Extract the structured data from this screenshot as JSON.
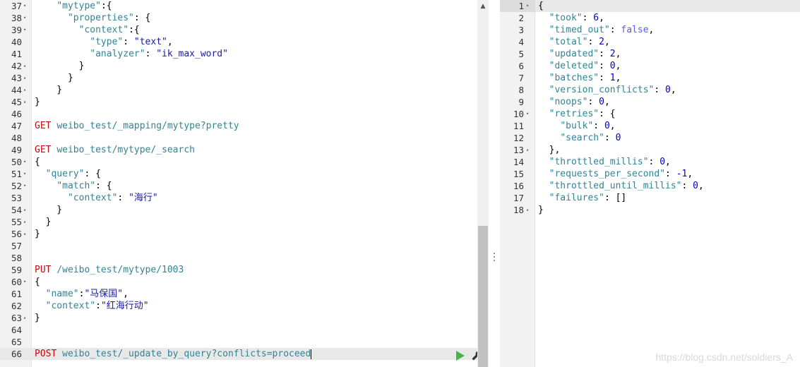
{
  "left_editor": {
    "lines": [
      {
        "n": "37",
        "fold": "▾",
        "tokens": [
          [
            "k",
            "    "
          ],
          [
            "key",
            "\"mytype\""
          ],
          [
            "k",
            ":{"
          ]
        ]
      },
      {
        "n": "38",
        "fold": "▾",
        "tokens": [
          [
            "k",
            "      "
          ],
          [
            "key",
            "\"properties\""
          ],
          [
            "k",
            ": {"
          ]
        ]
      },
      {
        "n": "39",
        "fold": "▾",
        "tokens": [
          [
            "k",
            "        "
          ],
          [
            "key",
            "\"context\""
          ],
          [
            "k",
            ":{"
          ]
        ]
      },
      {
        "n": "40",
        "fold": "",
        "tokens": [
          [
            "k",
            "          "
          ],
          [
            "key",
            "\"type\""
          ],
          [
            "k",
            ": "
          ],
          [
            "str",
            "\"text\""
          ],
          [
            "k",
            ","
          ]
        ]
      },
      {
        "n": "41",
        "fold": "",
        "tokens": [
          [
            "k",
            "          "
          ],
          [
            "key",
            "\"analyzer\""
          ],
          [
            "k",
            ": "
          ],
          [
            "str",
            "\"ik_max_word\""
          ]
        ]
      },
      {
        "n": "42",
        "fold": "▴",
        "tokens": [
          [
            "k",
            "        }"
          ]
        ]
      },
      {
        "n": "43",
        "fold": "▴",
        "tokens": [
          [
            "k",
            "      }"
          ]
        ]
      },
      {
        "n": "44",
        "fold": "▴",
        "tokens": [
          [
            "k",
            "    }"
          ]
        ]
      },
      {
        "n": "45",
        "fold": "▴",
        "tokens": [
          [
            "k",
            "}"
          ]
        ]
      },
      {
        "n": "46",
        "fold": "",
        "tokens": []
      },
      {
        "n": "47",
        "fold": "",
        "tokens": [
          [
            "method",
            "GET"
          ],
          [
            "k",
            " "
          ],
          [
            "url",
            "weibo_test/_mapping/mytype?pretty"
          ]
        ]
      },
      {
        "n": "48",
        "fold": "",
        "tokens": []
      },
      {
        "n": "49",
        "fold": "",
        "tokens": [
          [
            "method",
            "GET"
          ],
          [
            "k",
            " "
          ],
          [
            "url",
            "weibo_test/mytype/_search"
          ]
        ]
      },
      {
        "n": "50",
        "fold": "▾",
        "tokens": [
          [
            "k",
            "{"
          ]
        ]
      },
      {
        "n": "51",
        "fold": "▾",
        "tokens": [
          [
            "k",
            "  "
          ],
          [
            "key",
            "\"query\""
          ],
          [
            "k",
            ": {"
          ]
        ]
      },
      {
        "n": "52",
        "fold": "▾",
        "tokens": [
          [
            "k",
            "    "
          ],
          [
            "key",
            "\"match\""
          ],
          [
            "k",
            ": {"
          ]
        ]
      },
      {
        "n": "53",
        "fold": "",
        "tokens": [
          [
            "k",
            "      "
          ],
          [
            "key",
            "\"context\""
          ],
          [
            "k",
            ": "
          ],
          [
            "str",
            "\"海行\""
          ]
        ]
      },
      {
        "n": "54",
        "fold": "▴",
        "tokens": [
          [
            "k",
            "    }"
          ]
        ]
      },
      {
        "n": "55",
        "fold": "▴",
        "tokens": [
          [
            "k",
            "  }"
          ]
        ]
      },
      {
        "n": "56",
        "fold": "▴",
        "tokens": [
          [
            "k",
            "}"
          ]
        ]
      },
      {
        "n": "57",
        "fold": "",
        "tokens": []
      },
      {
        "n": "58",
        "fold": "",
        "tokens": []
      },
      {
        "n": "59",
        "fold": "",
        "tokens": [
          [
            "method",
            "PUT"
          ],
          [
            "k",
            " "
          ],
          [
            "url",
            "/weibo_test/mytype/1003"
          ]
        ]
      },
      {
        "n": "60",
        "fold": "▾",
        "tokens": [
          [
            "k",
            "{"
          ]
        ]
      },
      {
        "n": "61",
        "fold": "",
        "tokens": [
          [
            "k",
            "  "
          ],
          [
            "key",
            "\"name\""
          ],
          [
            "k",
            ":"
          ],
          [
            "str",
            "\"马保国\""
          ],
          [
            "k",
            ","
          ]
        ]
      },
      {
        "n": "62",
        "fold": "",
        "tokens": [
          [
            "k",
            "  "
          ],
          [
            "key",
            "\"context\""
          ],
          [
            "k",
            ":"
          ],
          [
            "str",
            "\"红海行动\""
          ]
        ]
      },
      {
        "n": "63",
        "fold": "▴",
        "tokens": [
          [
            "k",
            "}"
          ]
        ]
      },
      {
        "n": "64",
        "fold": "",
        "tokens": []
      },
      {
        "n": "65",
        "fold": "",
        "tokens": []
      },
      {
        "n": "66",
        "fold": "",
        "active": true,
        "tokens": [
          [
            "method",
            "POST"
          ],
          [
            "k",
            " "
          ],
          [
            "url",
            "weibo_test/_update_by_query?conflicts=proceed"
          ]
        ]
      }
    ]
  },
  "right_editor": {
    "lines": [
      {
        "n": "1",
        "fold": "▾",
        "tokens": [
          [
            "k",
            "{"
          ]
        ]
      },
      {
        "n": "2",
        "fold": "",
        "tokens": [
          [
            "k",
            "  "
          ],
          [
            "key",
            "\"took\""
          ],
          [
            "k",
            ": "
          ],
          [
            "num",
            "6"
          ],
          [
            "k",
            ","
          ]
        ]
      },
      {
        "n": "3",
        "fold": "",
        "tokens": [
          [
            "k",
            "  "
          ],
          [
            "key",
            "\"timed_out\""
          ],
          [
            "k",
            ": "
          ],
          [
            "bool",
            "false"
          ],
          [
            "k",
            ","
          ]
        ]
      },
      {
        "n": "4",
        "fold": "",
        "tokens": [
          [
            "k",
            "  "
          ],
          [
            "key",
            "\"total\""
          ],
          [
            "k",
            ": "
          ],
          [
            "num",
            "2"
          ],
          [
            "k",
            ","
          ]
        ]
      },
      {
        "n": "5",
        "fold": "",
        "tokens": [
          [
            "k",
            "  "
          ],
          [
            "key",
            "\"updated\""
          ],
          [
            "k",
            ": "
          ],
          [
            "num",
            "2"
          ],
          [
            "k",
            ","
          ]
        ]
      },
      {
        "n": "6",
        "fold": "",
        "tokens": [
          [
            "k",
            "  "
          ],
          [
            "key",
            "\"deleted\""
          ],
          [
            "k",
            ": "
          ],
          [
            "num",
            "0"
          ],
          [
            "k",
            ","
          ]
        ]
      },
      {
        "n": "7",
        "fold": "",
        "tokens": [
          [
            "k",
            "  "
          ],
          [
            "key",
            "\"batches\""
          ],
          [
            "k",
            ": "
          ],
          [
            "num",
            "1"
          ],
          [
            "k",
            ","
          ]
        ]
      },
      {
        "n": "8",
        "fold": "",
        "tokens": [
          [
            "k",
            "  "
          ],
          [
            "key",
            "\"version_conflicts\""
          ],
          [
            "k",
            ": "
          ],
          [
            "num",
            "0"
          ],
          [
            "k",
            ","
          ]
        ]
      },
      {
        "n": "9",
        "fold": "",
        "tokens": [
          [
            "k",
            "  "
          ],
          [
            "key",
            "\"noops\""
          ],
          [
            "k",
            ": "
          ],
          [
            "num",
            "0"
          ],
          [
            "k",
            ","
          ]
        ]
      },
      {
        "n": "10",
        "fold": "▾",
        "tokens": [
          [
            "k",
            "  "
          ],
          [
            "key",
            "\"retries\""
          ],
          [
            "k",
            ": {"
          ]
        ]
      },
      {
        "n": "11",
        "fold": "",
        "tokens": [
          [
            "k",
            "    "
          ],
          [
            "key",
            "\"bulk\""
          ],
          [
            "k",
            ": "
          ],
          [
            "num",
            "0"
          ],
          [
            "k",
            ","
          ]
        ]
      },
      {
        "n": "12",
        "fold": "",
        "tokens": [
          [
            "k",
            "    "
          ],
          [
            "key",
            "\"search\""
          ],
          [
            "k",
            ": "
          ],
          [
            "num",
            "0"
          ]
        ]
      },
      {
        "n": "13",
        "fold": "▴",
        "tokens": [
          [
            "k",
            "  },"
          ]
        ]
      },
      {
        "n": "14",
        "fold": "",
        "tokens": [
          [
            "k",
            "  "
          ],
          [
            "key",
            "\"throttled_millis\""
          ],
          [
            "k",
            ": "
          ],
          [
            "num",
            "0"
          ],
          [
            "k",
            ","
          ]
        ]
      },
      {
        "n": "15",
        "fold": "",
        "tokens": [
          [
            "k",
            "  "
          ],
          [
            "key",
            "\"requests_per_second\""
          ],
          [
            "k",
            ": "
          ],
          [
            "num",
            "-1"
          ],
          [
            "k",
            ","
          ]
        ]
      },
      {
        "n": "16",
        "fold": "",
        "tokens": [
          [
            "k",
            "  "
          ],
          [
            "key",
            "\"throttled_until_millis\""
          ],
          [
            "k",
            ": "
          ],
          [
            "num",
            "0"
          ],
          [
            "k",
            ","
          ]
        ]
      },
      {
        "n": "17",
        "fold": "",
        "tokens": [
          [
            "k",
            "  "
          ],
          [
            "key",
            "\"failures\""
          ],
          [
            "k",
            ": []"
          ]
        ]
      },
      {
        "n": "18",
        "fold": "▴",
        "tokens": [
          [
            "k",
            "}"
          ]
        ]
      }
    ]
  },
  "icons": {
    "run": "play-icon",
    "settings": "wrench-icon",
    "scroll_up": "scroll-up-arrow-icon",
    "divider": "vertical-dots-icon"
  },
  "colors": {
    "method": "#c5060b",
    "url": "#318495",
    "key": "#318495",
    "string": "#1a1aa6",
    "number": "#0000cd",
    "run": "#4caf50"
  },
  "watermark": "https://blog.csdn.net/soldiers_A"
}
